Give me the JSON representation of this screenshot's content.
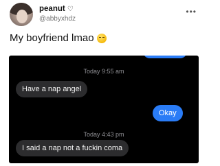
{
  "post": {
    "display_name": "peanut",
    "name_icon": "heart-outline-icon",
    "handle": "@abbyxhdz",
    "more_icon": "more-dots-icon",
    "caption": "My boyfriend lmao",
    "caption_emoji": "grin-sweat-emoji-icon"
  },
  "messages": {
    "timestamp_1": "Today 9:55 am",
    "incoming_1": "Have a nap angel",
    "outgoing_1": "Okay",
    "timestamp_2": "Today 4:43 pm",
    "incoming_2": "I said a nap not a fuckin coma"
  },
  "colors": {
    "outgoing_bubble": "#2a7cf6",
    "incoming_bubble": "#2c2c2e",
    "chat_background": "#000000"
  }
}
